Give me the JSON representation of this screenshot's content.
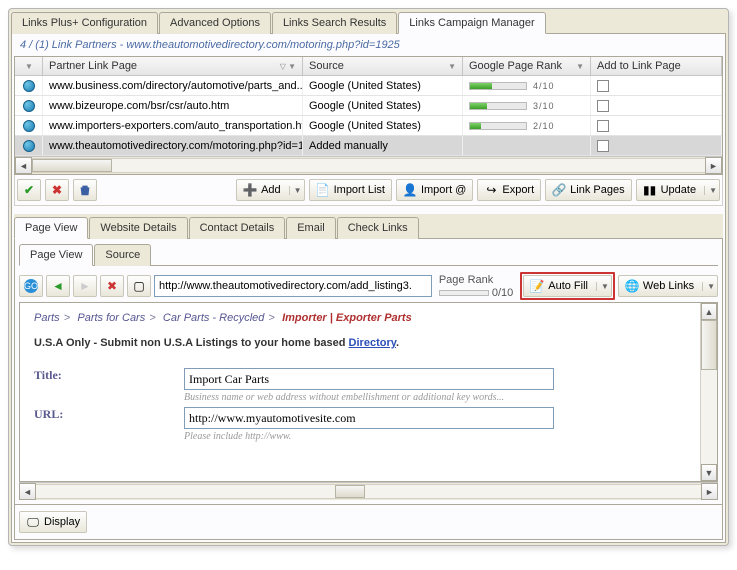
{
  "main_tabs": {
    "config": "Links Plus+ Configuration",
    "advanced": "Advanced Options",
    "search": "Links Search Results",
    "campaign": "Links Campaign Manager"
  },
  "title": {
    "count": "4 / (1) Link Partners  - ",
    "url": "www.theautomotivedirectory.com/motoring.php?id=1925"
  },
  "grid": {
    "headers": {
      "partner": "Partner Link Page",
      "source": "Source",
      "rank": "Google Page Rank",
      "add": "Add to Link Page"
    },
    "rows": [
      {
        "partner": "www.business.com/directory/automotive/parts_and...",
        "source": "Google (United States)",
        "rank": 4,
        "rankTxt": "4/10",
        "sel": false
      },
      {
        "partner": "www.bizeurope.com/bsr/csr/auto.htm",
        "source": "Google (United States)",
        "rank": 3,
        "rankTxt": "3/10",
        "sel": false
      },
      {
        "partner": "www.importers-exporters.com/auto_transportation.htm",
        "source": "Google (United States)",
        "rank": 2,
        "rankTxt": "2/10",
        "sel": false
      },
      {
        "partner": "www.theautomotivedirectory.com/motoring.php?id=1...",
        "source": "Added manually",
        "rank": 0,
        "rankTxt": "",
        "sel": true
      }
    ]
  },
  "toolbar": {
    "add": "Add",
    "import_list": "Import List",
    "import_at": "Import @",
    "export": "Export",
    "link_pages": "Link Pages",
    "update": "Update"
  },
  "sub_tabs": {
    "page_view": "Page View",
    "website": "Website Details",
    "contact": "Contact Details",
    "email": "Email",
    "check": "Check Links"
  },
  "inner_tabs": {
    "page_view": "Page View",
    "source": "Source"
  },
  "addr": {
    "url": "http://www.theautomotivedirectory.com/add_listing3.",
    "page_rank_label": "Page Rank",
    "page_rank_value": "0/10",
    "auto_fill": "Auto Fill",
    "web_links": "Web Links"
  },
  "render": {
    "crumbs": {
      "p1": "Parts",
      "p2": "Parts for Cars",
      "p3": "Car Parts - Recycled",
      "final": "Importer | Exporter Parts"
    },
    "blurb_a": "U.S.A Only - Submit non U.S.A Listings to your home based ",
    "blurb_link": "Directory",
    "title_label": "Title:",
    "title_value": "Import Car Parts",
    "title_hint": "Business name or web address without embellishment or additional key words...",
    "url_label": "URL:",
    "url_value": "http://www.myautomotivesite.com",
    "url_hint": "Please include http://www."
  },
  "bottom": {
    "display": "Display"
  }
}
